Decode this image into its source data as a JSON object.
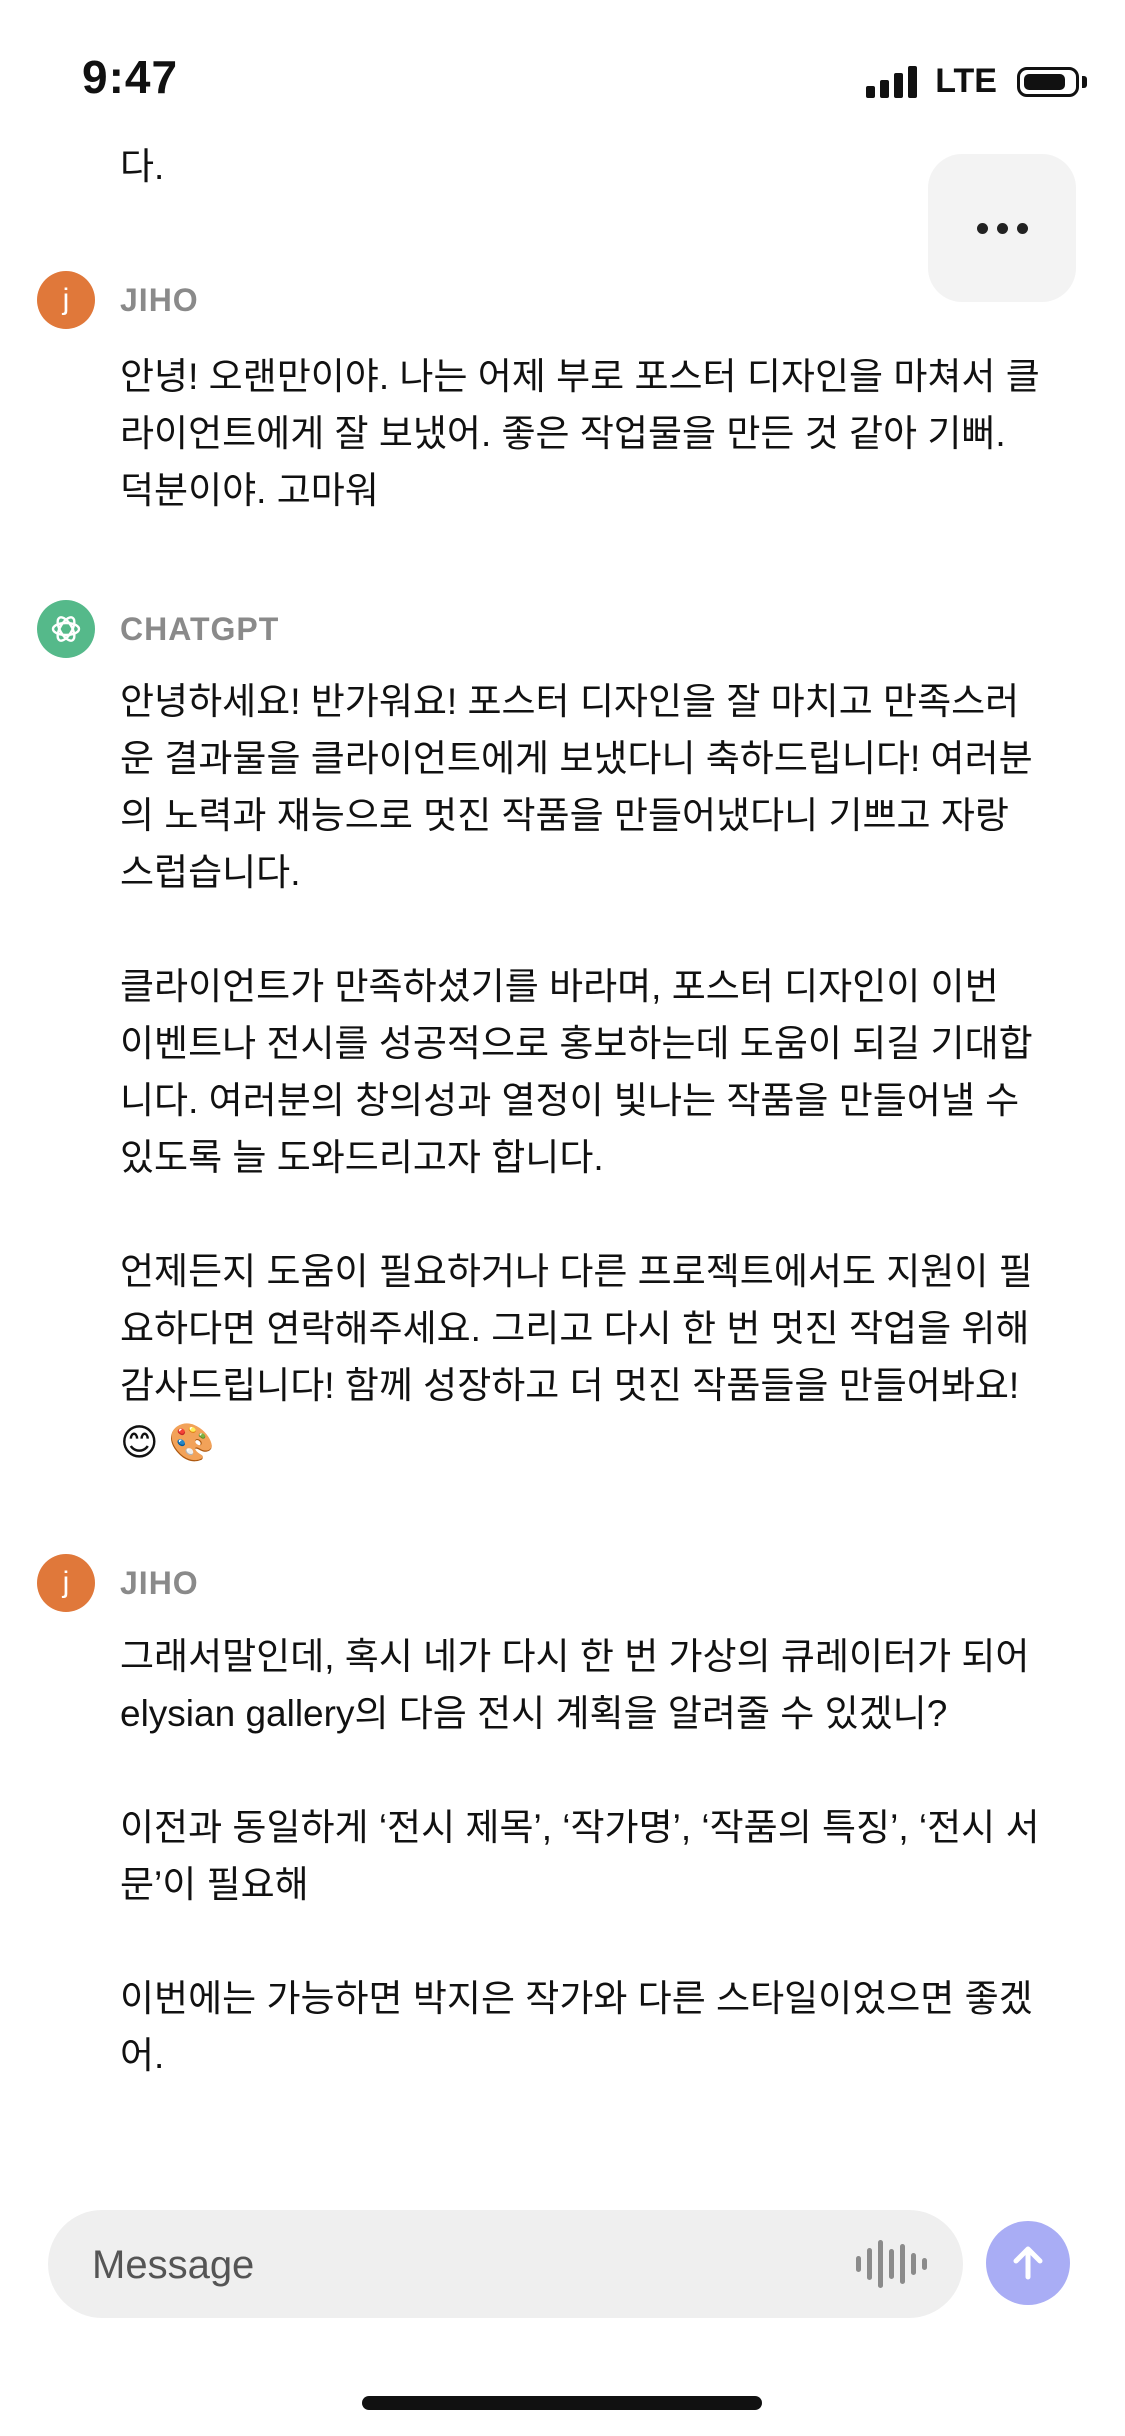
{
  "status_bar": {
    "time": "9:47",
    "network": "LTE",
    "battery_level": 0.85
  },
  "chat": {
    "top_fragment": "다.",
    "messages": [
      {
        "sender": "JIHO",
        "avatar_letter": "j",
        "paragraphs": [
          "안녕! 오랜만이야. 나는 어제 부로 포스터 디자인을 마쳐서 클라이언트에게 잘 보냈어. 좋은 작업물을 만든 것 같아 기뻐. 덕분이야. 고마워"
        ]
      },
      {
        "sender": "CHATGPT",
        "paragraphs": [
          "안녕하세요! 반가워요! 포스터 디자인을 잘 마치고 만족스러운 결과물을 클라이언트에게 보냈다니 축하드립니다! 여러분의 노력과 재능으로 멋진 작품을 만들어냈다니 기쁘고 자랑스럽습니다.",
          "클라이언트가 만족하셨기를 바라며, 포스터 디자인이 이번 이벤트나 전시를 성공적으로 홍보하는데 도움이 되길 기대합니다. 여러분의 창의성과 열정이 빛나는 작품을 만들어낼 수 있도록 늘 도와드리고자 합니다.",
          "언제든지 도움이 필요하거나 다른 프로젝트에서도 지원이 필요하다면 연락해주세요. 그리고 다시 한 번 멋진 작업을 위해 감사드립니다! 함께 성장하고 더 멋진 작품들을 만들어봐요! 😊 🎨"
        ]
      },
      {
        "sender": "JIHO",
        "avatar_letter": "j",
        "paragraphs": [
          "그래서말인데, 혹시 네가 다시 한 번 가상의 큐레이터가 되어 elysian gallery의 다음 전시 계획을 알려줄 수 있겠니?",
          "이전과 동일하게 ‘전시 제목’, ‘작가명’, ‘작품의 특징’, ‘전시 서문’이 필요해",
          "이번에는 가능하면 박지은 작가와 다른 스타일이었으면 좋겠어."
        ]
      }
    ]
  },
  "composer": {
    "placeholder": "Message"
  },
  "colors": {
    "user_avatar": "#e0783a",
    "assistant_avatar": "#55b98a",
    "send_button": "#a9adf5"
  },
  "icons": [
    "more-icon",
    "openai-logo-icon",
    "voice-waveform-icon",
    "arrow-up-icon",
    "signal-icon",
    "battery-icon"
  ]
}
